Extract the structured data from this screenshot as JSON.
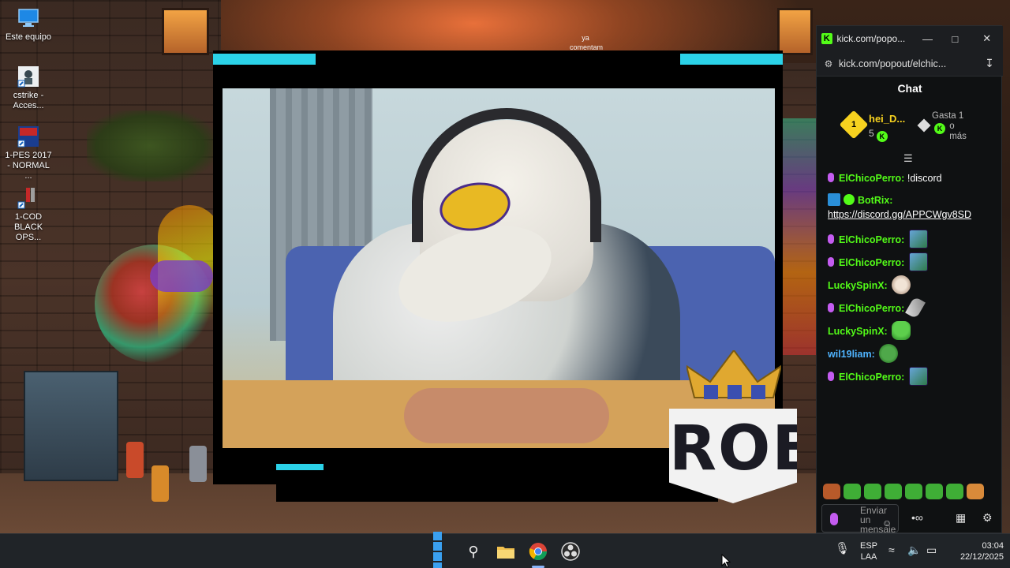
{
  "desktop": {
    "icons": [
      {
        "label": "Este equipo",
        "icon": "monitor-icon"
      },
      {
        "label": "cstrike - Acces...",
        "icon": "game-shortcut-icon"
      },
      {
        "label": "1-PES 2017 - NORMAL ...",
        "icon": "game-shortcut-icon"
      },
      {
        "label": "1-COD BLACK OPS...",
        "icon": "game-shortcut-icon"
      }
    ],
    "wallpaper_text": "ya comentam"
  },
  "overlay": {
    "logo_text": "ROB",
    "accent_color": "#2bd2e8"
  },
  "chat_window": {
    "tab_title": "kick.com/popo...",
    "url": "kick.com/popout/elchic...",
    "header": "Chat",
    "leaderboard": {
      "rank": "1",
      "name": "hei_D...",
      "amount": "5",
      "gasta_label": "Gasta 1",
      "o_mas": "o más"
    },
    "messages": [
      {
        "user": "ElChicoPerro:",
        "text": "!discord",
        "emote": ""
      },
      {
        "user": "BotRix:",
        "text": "https://discord.gg/APPCWgv8SD",
        "emote": ""
      },
      {
        "user": "ElChicoPerro:",
        "text": "",
        "emote": "pixel-emote"
      },
      {
        "user": "ElChicoPerro:",
        "text": "",
        "emote": "pixel-emote"
      },
      {
        "user": "LuckySpinX:",
        "text": "",
        "emote": "cat-emote"
      },
      {
        "user": "ElChicoPerro:",
        "text": "",
        "emote": "feather-emote"
      },
      {
        "user": "LuckySpinX:",
        "text": "",
        "emote": "pepe-emote"
      },
      {
        "user": "wil19liam:",
        "text": "",
        "emote": "frog-emote"
      },
      {
        "user": "ElChicoPerro:",
        "text": "",
        "emote": "pixel-emote"
      }
    ],
    "input_placeholder": "Enviar un mensaje",
    "brand_color": "#53fc18"
  },
  "taskbar": {
    "language": "ESP",
    "layout": "LAA",
    "time": "03:04",
    "date": "22/12/2025"
  }
}
